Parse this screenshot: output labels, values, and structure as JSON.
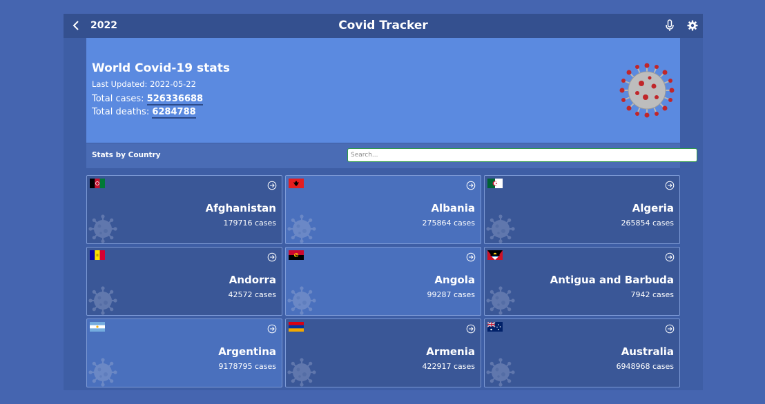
{
  "header": {
    "year": "2022",
    "title": "Covid Tracker",
    "back_icon": "chevron-left-icon",
    "mic_icon": "microphone-icon",
    "settings_icon": "gear-icon"
  },
  "world": {
    "heading": "World Covid-19 stats",
    "last_updated": "Last Updated: 2022-05-22",
    "total_cases_label": "Total cases:",
    "total_cases": "526336688",
    "total_deaths_label": "Total deaths:",
    "total_deaths": "6284788"
  },
  "stats_bar": {
    "label": "Stats by Country",
    "search_placeholder": "Search..."
  },
  "countries": [
    {
      "name": "Afghanistan",
      "cases": "179716 cases",
      "flag": "afghanistan"
    },
    {
      "name": "Albania",
      "cases": "275864 cases",
      "flag": "albania"
    },
    {
      "name": "Algeria",
      "cases": "265854 cases",
      "flag": "algeria"
    },
    {
      "name": "Andorra",
      "cases": "42572 cases",
      "flag": "andorra"
    },
    {
      "name": "Angola",
      "cases": "99287 cases",
      "flag": "angola"
    },
    {
      "name": "Antigua and Barbuda",
      "cases": "7942 cases",
      "flag": "antigua"
    },
    {
      "name": "Argentina",
      "cases": "9178795 cases",
      "flag": "argentina"
    },
    {
      "name": "Armenia",
      "cases": "422917 cases",
      "flag": "armenia"
    },
    {
      "name": "Australia",
      "cases": "6948968 cases",
      "flag": "australia"
    }
  ]
}
